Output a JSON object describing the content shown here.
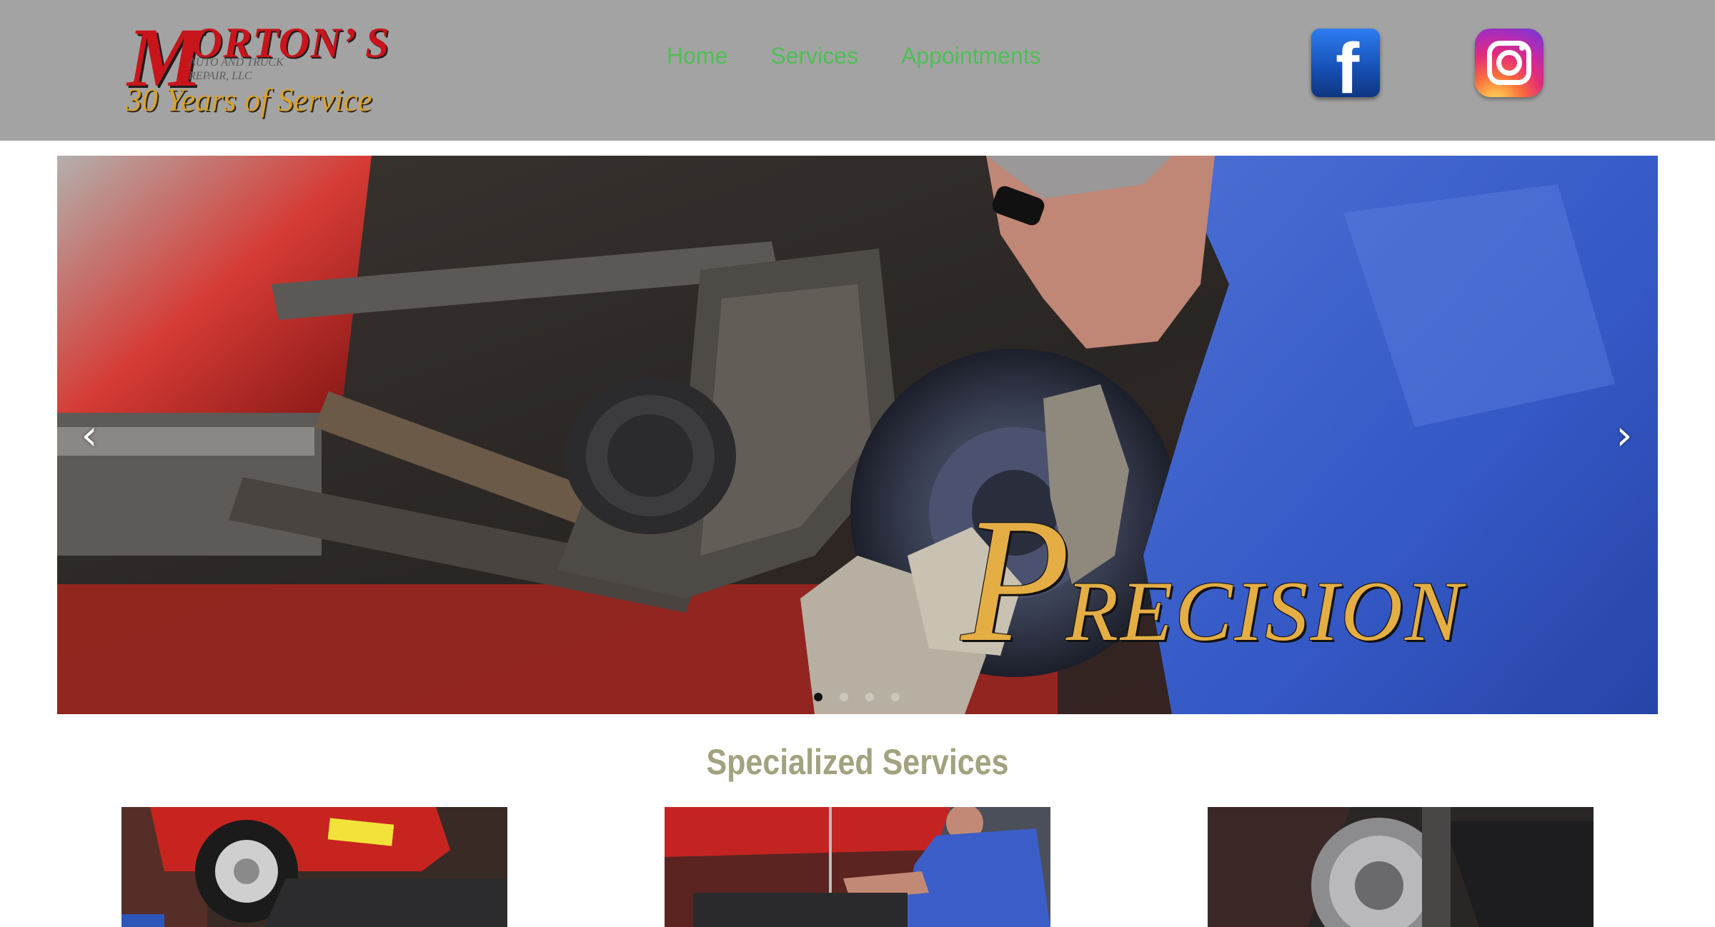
{
  "header": {
    "logo": {
      "initial": "M",
      "name_rest": "ORTON’ S",
      "subtitle": "AUTO AND TRUCK REPAIR, LLC",
      "tagline": "30 Years of Service"
    },
    "nav": [
      {
        "label": "Home"
      },
      {
        "label": "Services"
      },
      {
        "label": "Appointments"
      }
    ],
    "social": {
      "facebook_icon": "facebook-icon",
      "instagram_icon": "instagram-icon"
    }
  },
  "hero": {
    "caption_initial": "P",
    "caption_rest": "RECISION",
    "prev_icon": "chevron-left-icon",
    "next_icon": "chevron-right-icon",
    "prev_glyph": "‹",
    "next_glyph": "›",
    "slide_count": 4,
    "active_slide": 1
  },
  "services": {
    "title": "Specialized Services"
  },
  "colors": {
    "header_bg": "#a3a3a3",
    "nav_link": "#4ebf56",
    "logo_red": "#c8151b",
    "logo_gold": "#d9a22b",
    "caption_gold": "#e4ae45",
    "section_title": "#a3a280"
  }
}
